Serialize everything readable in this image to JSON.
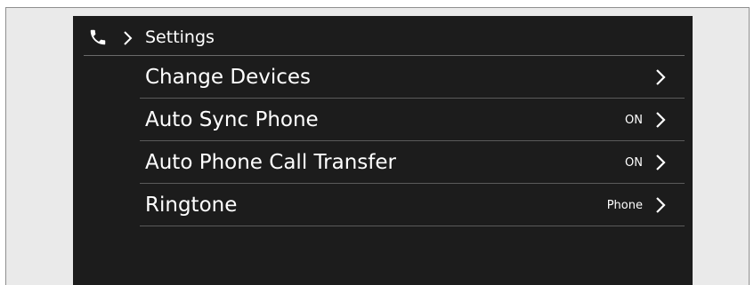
{
  "header": {
    "title": "Settings",
    "breadcrumb_icon": "phone-icon",
    "separator_icon": "chevron-right-icon"
  },
  "settings": {
    "items": [
      {
        "label": "Change Devices",
        "value": "",
        "icon": "chevron-right-icon"
      },
      {
        "label": "Auto Sync Phone",
        "value": "ON",
        "icon": "chevron-right-icon"
      },
      {
        "label": "Auto Phone Call Transfer",
        "value": "ON",
        "icon": "chevron-right-icon"
      },
      {
        "label": "Ringtone",
        "value": "Phone",
        "icon": "chevron-right-icon"
      }
    ]
  },
  "colors": {
    "screen_background": "#1c1c1c",
    "text": "#ffffff",
    "divider": "#5a5a5a",
    "page_background": "#ffffff"
  }
}
